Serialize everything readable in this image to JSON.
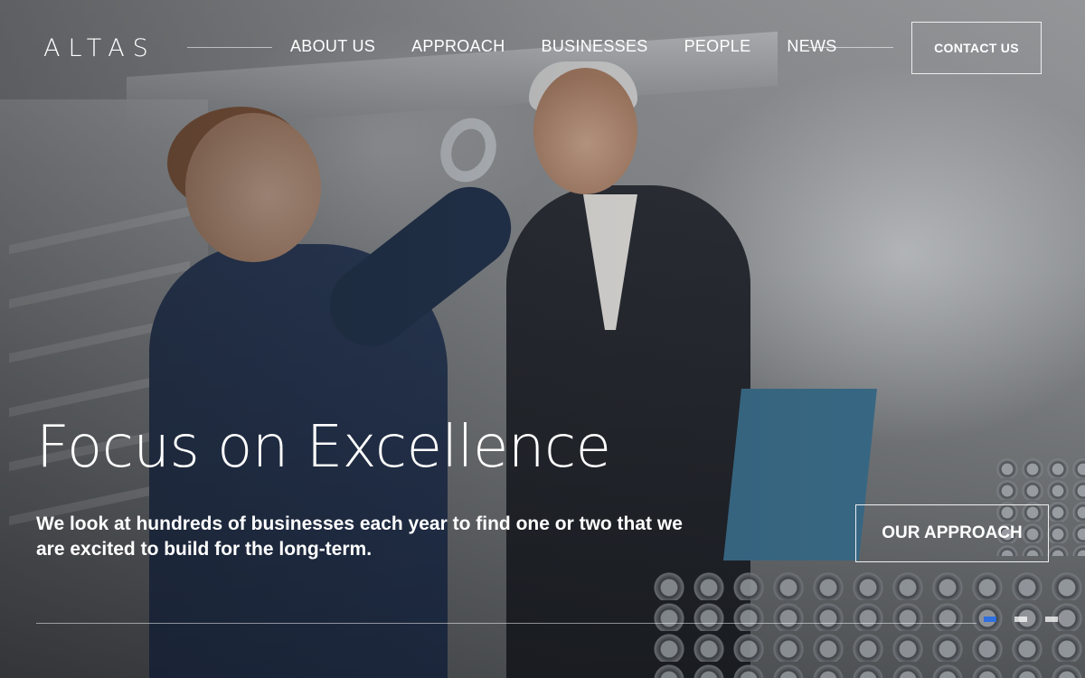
{
  "brand": {
    "logo_text": "ALTAS"
  },
  "nav": {
    "items": [
      {
        "label": "ABOUT US"
      },
      {
        "label": "APPROACH"
      },
      {
        "label": "BUSINESSES"
      },
      {
        "label": "PEOPLE"
      },
      {
        "label": "NEWS"
      }
    ],
    "contact_label": "CONTACT US"
  },
  "hero": {
    "headline": "Focus on Excellence",
    "subtext": "We look at hundreds of businesses each year to find one or two that we are excited to build for the long-term.",
    "cta_label": "OUR APPROACH"
  },
  "slider": {
    "slide_count": 3,
    "active_index": 0,
    "active_color": "#2f6fe0"
  }
}
